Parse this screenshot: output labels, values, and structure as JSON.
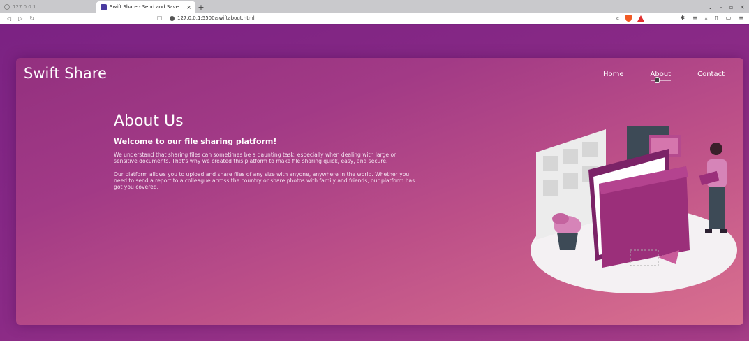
{
  "browser": {
    "inactive_tab_title": "127.0.0.1",
    "active_tab_title": "Swift Share - Send and Save",
    "tab_close": "×",
    "new_tab": "+",
    "url": "127.0.0.1:5500/swiftabout.html"
  },
  "header": {
    "brand": "Swift Share",
    "nav": [
      "Home",
      "About",
      "Contact"
    ],
    "active_nav": "About"
  },
  "main": {
    "title": "About Us",
    "subtitle": "Welcome to our file sharing platform!",
    "paragraphs": [
      "We understand that sharing files can sometimes be a daunting task, especially when dealing with large or sensitive documents. That's why we created this platform to make file sharing quick, easy, and secure.",
      "Our platform allows you to upload and share files of any size with anyone, anywhere in the world. Whether you need to send a report to a colleague across the country or share photos with family and friends, our platform has got you covered."
    ]
  },
  "colors": {
    "accent": "#a63d86",
    "folder": "#9b2f7a",
    "dark": "#3d4a56"
  },
  "illustration": {
    "icon": "file-sharing-illustration"
  }
}
